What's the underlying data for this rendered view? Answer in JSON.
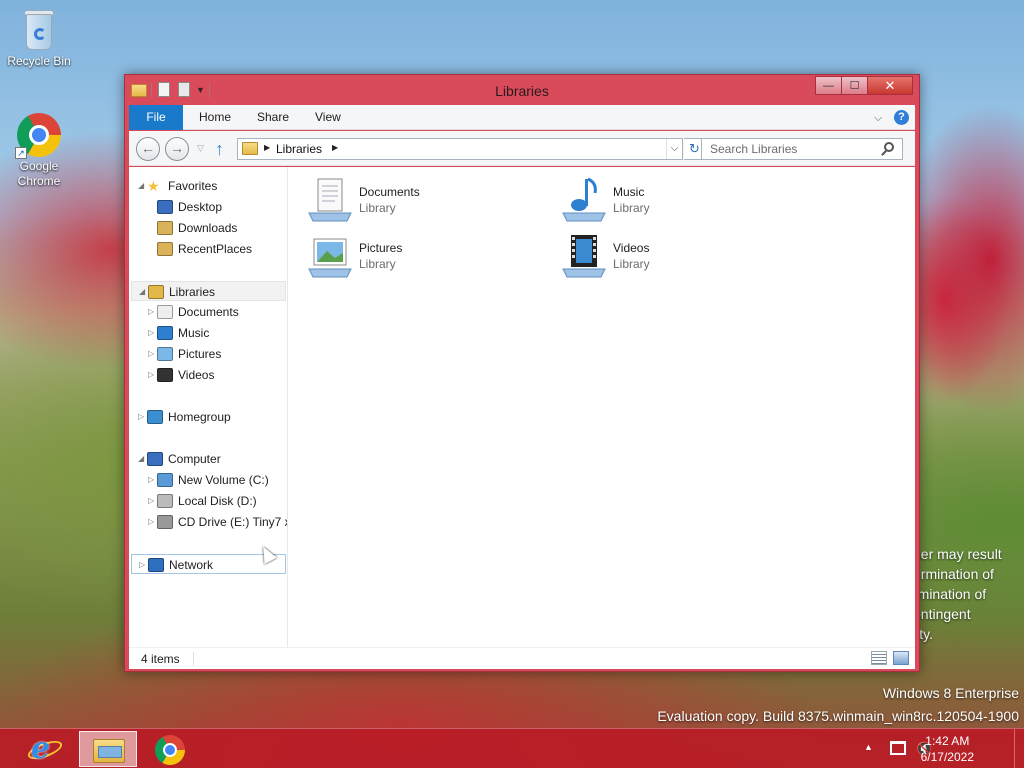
{
  "desktop": {
    "icons": [
      {
        "label": "Recycle Bin",
        "icon": "recycle-bin-icon"
      },
      {
        "label": "Google Chrome",
        "icon": "chrome-icon"
      }
    ],
    "watermark": {
      "edition": "Windows 8 Enterprise",
      "build": "Evaluation copy. Build 8375.winmain_win8rc.120504-1900"
    },
    "license_text": [
      "ner may result",
      "ermination of",
      "rmination of",
      "ontingent",
      "lity."
    ]
  },
  "window": {
    "title": "Libraries",
    "controls": {
      "minimize": "—",
      "maximize": "☐",
      "close": "✕"
    },
    "ribbon_tabs": [
      "File",
      "Home",
      "Share",
      "View"
    ],
    "address": {
      "crumb": "Libraries"
    },
    "search": {
      "placeholder": "Search Libraries",
      "value": ""
    },
    "nav_tree": [
      {
        "label": "Favorites",
        "icon": "star-icon",
        "level": 0,
        "expander": "◢"
      },
      {
        "label": "Desktop",
        "icon": "desktop-icon",
        "level": 1
      },
      {
        "label": "Downloads",
        "icon": "downloads-icon",
        "level": 1
      },
      {
        "label": "RecentPlaces",
        "icon": "recent-places-icon",
        "level": 1
      },
      {
        "label": "Libraries",
        "icon": "libraries-icon",
        "level": 0,
        "expander": "◢",
        "selected": true
      },
      {
        "label": "Documents",
        "icon": "documents-icon",
        "level": 1,
        "expander": "▷"
      },
      {
        "label": "Music",
        "icon": "music-icon",
        "level": 1,
        "expander": "▷"
      },
      {
        "label": "Pictures",
        "icon": "pictures-icon",
        "level": 1,
        "expander": "▷"
      },
      {
        "label": "Videos",
        "icon": "videos-icon",
        "level": 1,
        "expander": "▷"
      },
      {
        "label": "Homegroup",
        "icon": "homegroup-icon",
        "level": 0,
        "expander": "▷"
      },
      {
        "label": "Computer",
        "icon": "computer-icon",
        "level": 0,
        "expander": "◢"
      },
      {
        "label": "New Volume (C:)",
        "icon": "drive-c-icon",
        "level": 1,
        "expander": "▷"
      },
      {
        "label": "Local Disk (D:)",
        "icon": "drive-d-icon",
        "level": 1,
        "expander": "▷"
      },
      {
        "label": "CD Drive (E:) Tiny7 x",
        "icon": "cd-drive-icon",
        "level": 1,
        "expander": "▷"
      },
      {
        "label": "Network",
        "icon": "network-icon",
        "level": 0,
        "expander": "▷",
        "hover": true
      }
    ],
    "libraries": [
      {
        "name": "Documents",
        "type": "Library",
        "icon": "documents-library-icon"
      },
      {
        "name": "Music",
        "type": "Library",
        "icon": "music-library-icon"
      },
      {
        "name": "Pictures",
        "type": "Library",
        "icon": "pictures-library-icon"
      },
      {
        "name": "Videos",
        "type": "Library",
        "icon": "videos-library-icon"
      }
    ],
    "status": {
      "count": "4 items"
    }
  },
  "taskbar": {
    "apps": [
      {
        "name": "Internet Explorer",
        "icon": "internet-explorer-icon"
      },
      {
        "name": "File Explorer",
        "icon": "file-explorer-icon",
        "active": true
      },
      {
        "name": "Google Chrome",
        "icon": "chrome-icon"
      }
    ],
    "clock": {
      "time": "1:42 AM",
      "date": "6/17/2022"
    }
  },
  "colors": {
    "window_frame": "#d94a5a",
    "taskbar": "#b91c26",
    "ribbon_file": "#1979ca"
  }
}
